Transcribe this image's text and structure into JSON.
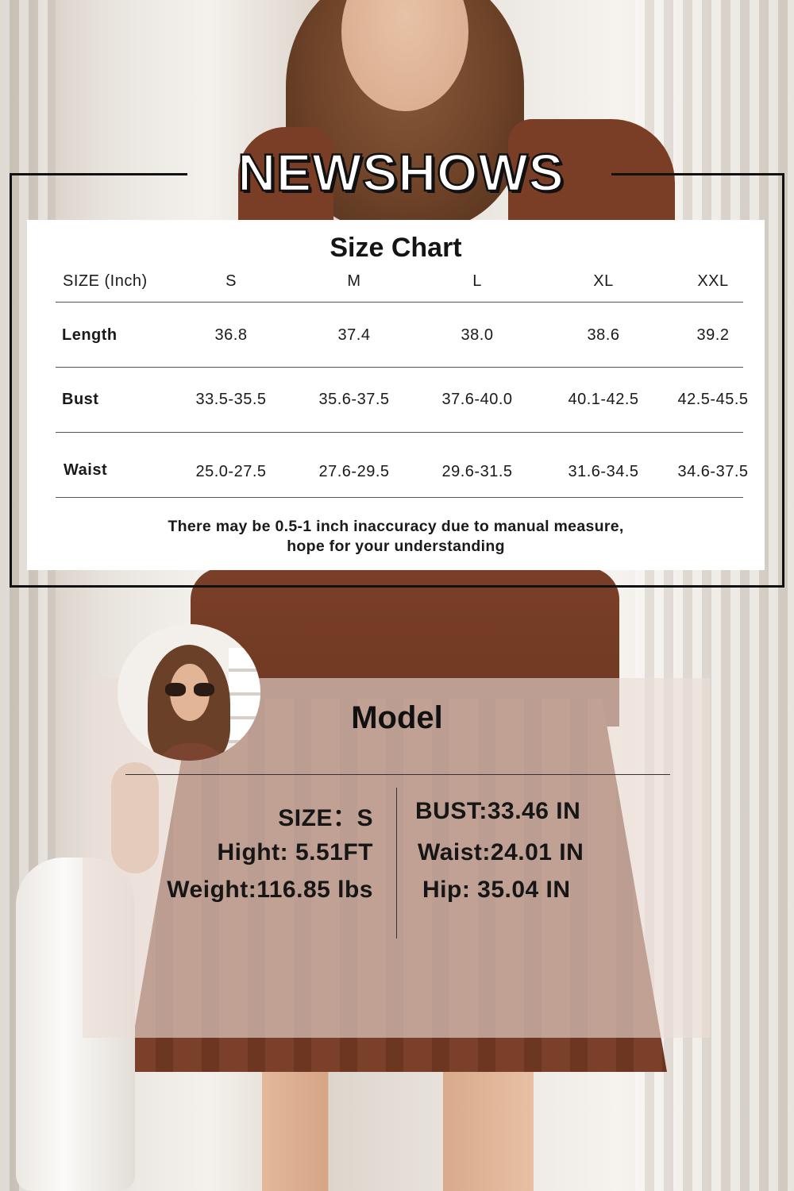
{
  "brand": {
    "name": "NEWSHOWS"
  },
  "size_chart": {
    "title": "Size Chart",
    "header": {
      "label": "SIZE (Inch)",
      "sizes": [
        "S",
        "M",
        "L",
        "XL",
        "XXL"
      ]
    },
    "rows": [
      {
        "label": "Length",
        "values": [
          "36.8",
          "37.4",
          "38.0",
          "38.6",
          "39.2"
        ]
      },
      {
        "label": "Bust",
        "values": [
          "33.5-35.5",
          "35.6-37.5",
          "37.6-40.0",
          "40.1-42.5",
          "42.5-45.5"
        ]
      },
      {
        "label": "Waist",
        "values": [
          "25.0-27.5",
          "27.6-29.5",
          "29.6-31.5",
          "31.6-34.5",
          "34.6-37.5"
        ]
      }
    ],
    "note_line1": "There may be 0.5-1 inch inaccuracy due to manual measure,",
    "note_line2": "hope for your understanding"
  },
  "model": {
    "title": "Model",
    "left_stats": [
      "SIZE：S",
      "Hight: 5.51FT",
      "Weight:116.85 lbs"
    ],
    "right_stats": [
      "BUST:33.46 IN",
      "Waist:24.01 IN",
      "Hip: 35.04 IN"
    ]
  },
  "colors": {
    "dress": "#7a3f28",
    "card_white": "#ffffff",
    "model_card": "#ecddd7",
    "text": "#141414"
  }
}
